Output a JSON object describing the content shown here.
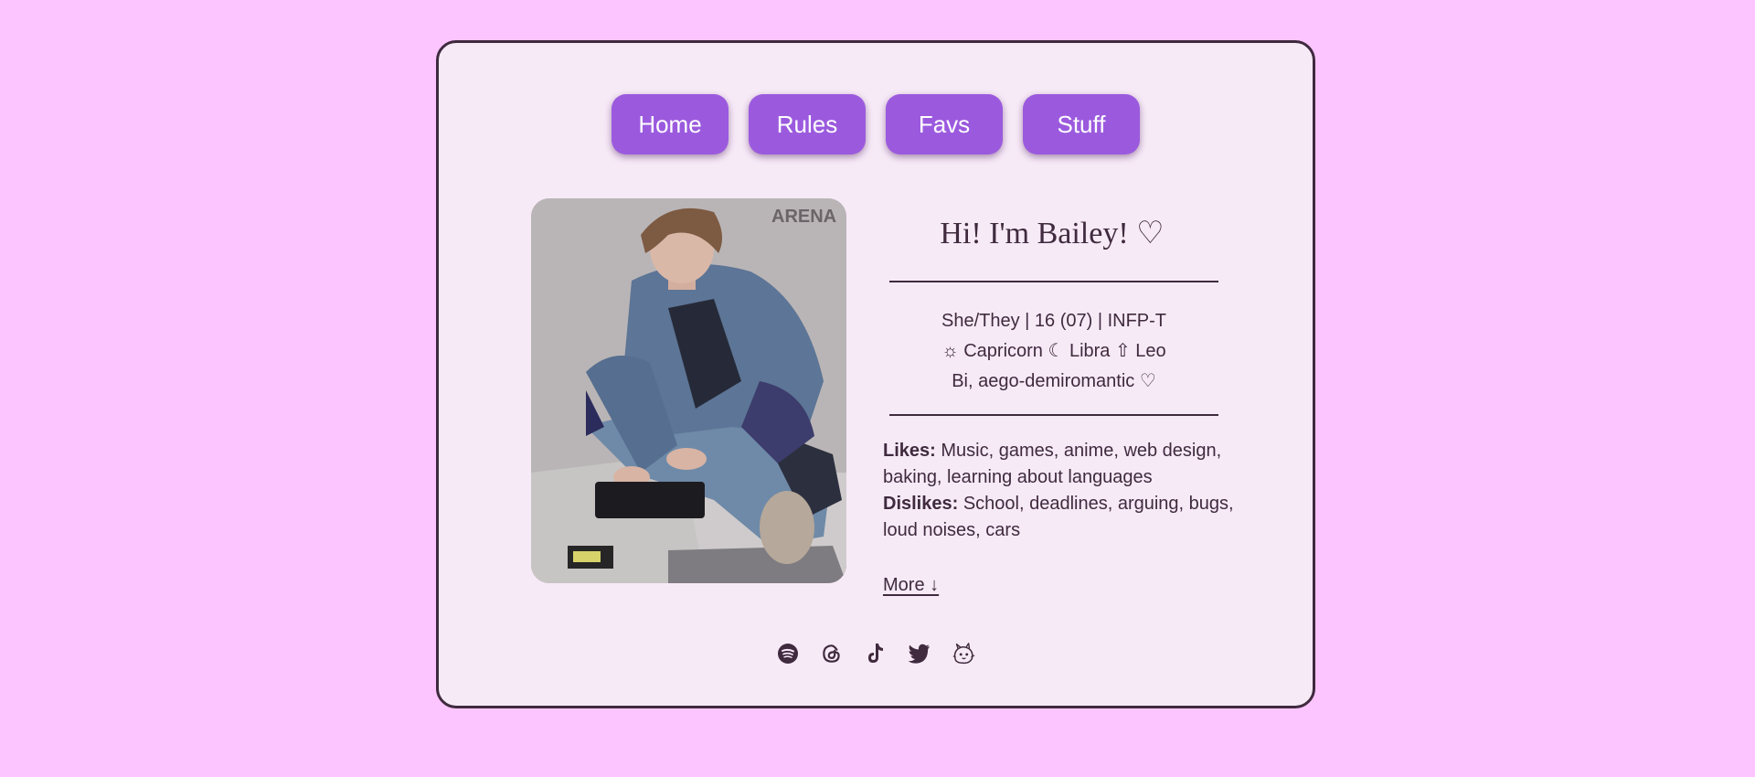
{
  "nav": {
    "items": [
      {
        "label": "Home"
      },
      {
        "label": "Rules"
      },
      {
        "label": "Favs"
      },
      {
        "label": "Stuff"
      }
    ]
  },
  "photo": {
    "watermark": "ARENA"
  },
  "profile": {
    "greeting": "Hi! I'm Bailey! ♡",
    "info_lines": [
      "She/They | 16 (07) | INFP-T",
      "☼ Capricorn ☾ Libra ⇧ Leo",
      "Bi, aego-demiromantic ♡"
    ],
    "likes_label": "Likes:",
    "likes_text": " Music, games, anime, web design, baking, learning about languages",
    "dislikes_label": "Dislikes:",
    "dislikes_text": " School, deadlines, arguing, bugs, loud noises, cars",
    "more_label": "More ↓"
  },
  "socials": [
    {
      "icon": "spotify-icon"
    },
    {
      "icon": "threads-icon"
    },
    {
      "icon": "tiktok-icon"
    },
    {
      "icon": "twitter-icon"
    },
    {
      "icon": "mascot-icon"
    }
  ],
  "colors": {
    "background": "#fcc5ff",
    "card": "#f7eaf7",
    "accent": "#9b5ade",
    "text": "#3f2a3e"
  }
}
